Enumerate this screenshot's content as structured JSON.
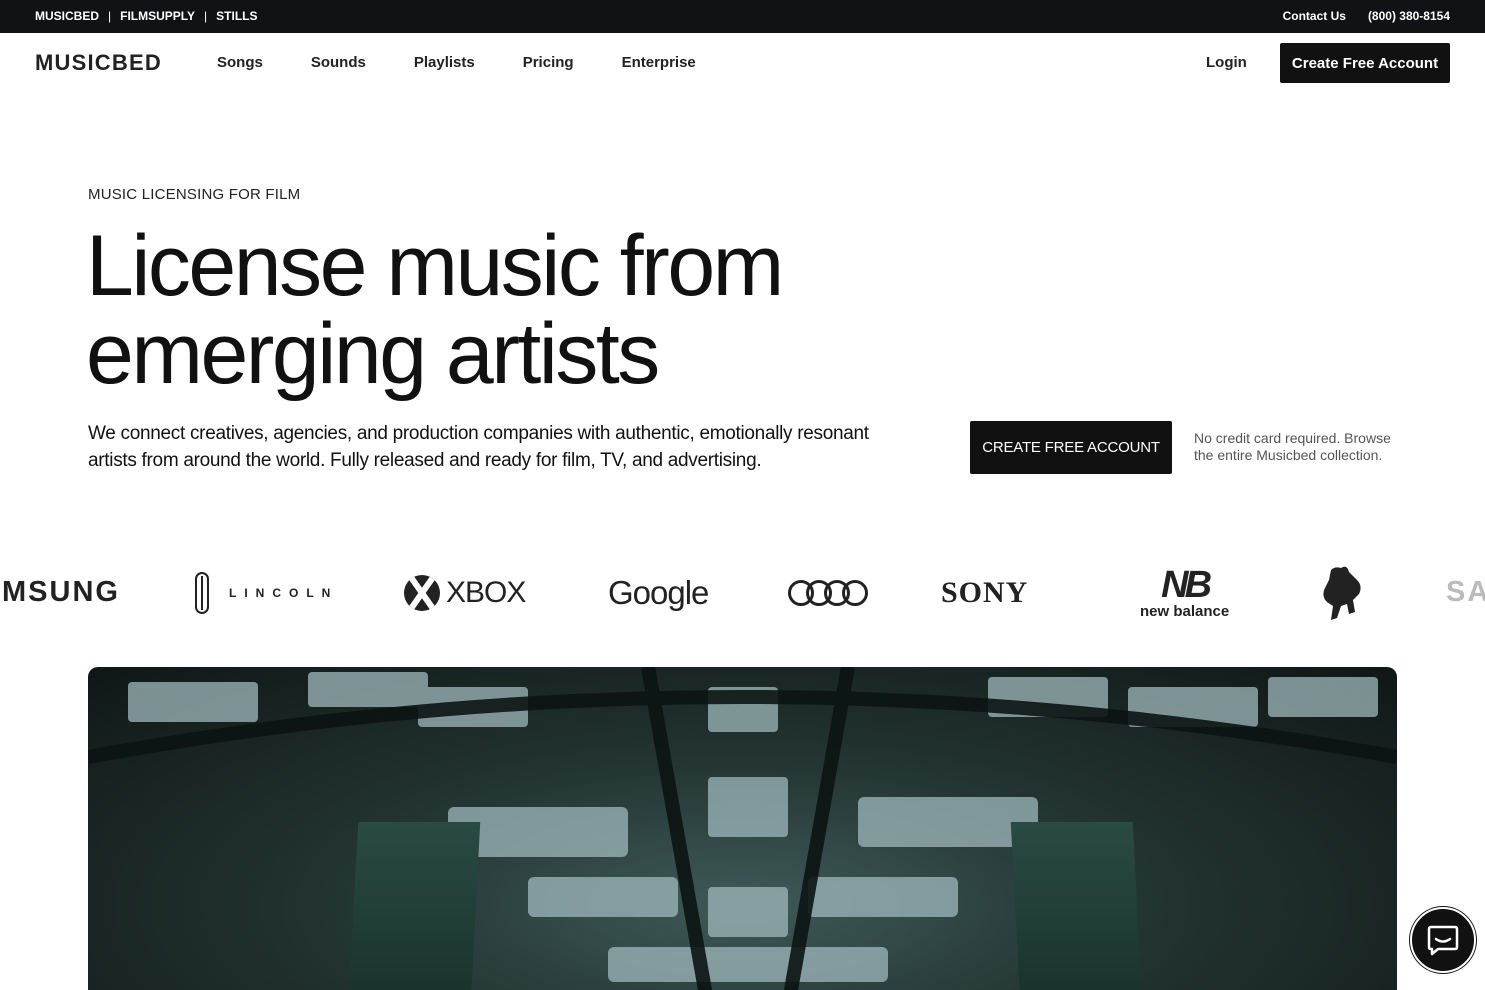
{
  "topbar": {
    "brands": [
      "MUSICBED",
      "FILMSUPPLY",
      "STILLS"
    ],
    "separator": "|",
    "contact": "Contact Us",
    "phone": "(800) 380-8154"
  },
  "nav": {
    "logo": "MUSICBED",
    "links": [
      "Songs",
      "Sounds",
      "Playlists",
      "Pricing",
      "Enterprise"
    ],
    "login": "Login",
    "cta": "Create Free Account"
  },
  "hero": {
    "eyebrow": "MUSIC LICENSING FOR FILM",
    "headline_line1": "License music from",
    "headline_line2": "emerging artists",
    "subcopy": "We connect creatives, agencies, and production companies with authentic, emotionally resonant artists from around the world. Fully released and ready for film, TV, and advertising.",
    "cta": "CREATE FREE ACCOUNT",
    "note": "No credit card required. Browse the entire Musicbed collection."
  },
  "logos": {
    "samsung": "MSUNG",
    "lincoln": "LINCOLN",
    "xbox": "XBOX",
    "google": "Google",
    "sony": "SONY",
    "nb_mark": "NB",
    "nb_word": "new balance",
    "samsung_repeat": "SA"
  },
  "icons": {
    "chat": "chat-bubble-icon",
    "xbox": "xbox-orb-icon",
    "audi": "audi-rings-icon",
    "lambo": "lamborghini-bull-icon",
    "lincoln": "lincoln-star-icon"
  },
  "colors": {
    "dark": "#111111",
    "white": "#ffffff"
  }
}
